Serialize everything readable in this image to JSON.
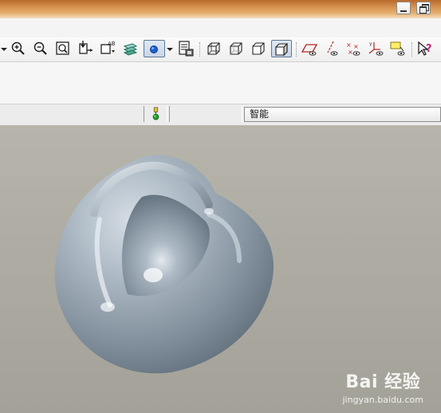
{
  "window": {
    "minimize_icon": "minimize-icon",
    "restore_icon": "restore-icon"
  },
  "toolbar": {
    "buttons": [
      {
        "name": "zoom-in",
        "icon": "zoom-in-icon"
      },
      {
        "name": "zoom-out",
        "icon": "zoom-out-icon"
      },
      {
        "name": "refit",
        "icon": "refit-icon"
      },
      {
        "name": "reorient",
        "icon": "reorient-icon"
      },
      {
        "name": "saved-views",
        "icon": "saved-views-icon"
      },
      {
        "name": "layers",
        "icon": "layers-icon"
      },
      {
        "name": "display-style",
        "icon": "display-style-icon",
        "pressed": true
      },
      {
        "name": "view-manager",
        "icon": "view-manager-icon"
      },
      {
        "name": "wireframe",
        "icon": "wireframe-icon"
      },
      {
        "name": "hidden-line",
        "icon": "hidden-line-icon"
      },
      {
        "name": "no-hidden",
        "icon": "no-hidden-icon"
      },
      {
        "name": "shading",
        "icon": "shading-icon",
        "pressed": true
      },
      {
        "name": "datum-planes",
        "icon": "datum-planes-icon"
      },
      {
        "name": "datum-axes",
        "icon": "datum-axes-icon"
      },
      {
        "name": "datum-points",
        "icon": "datum-points-icon"
      },
      {
        "name": "coordinate-systems",
        "icon": "coordinate-systems-icon"
      },
      {
        "name": "annotations",
        "icon": "annotations-icon"
      },
      {
        "name": "context-help",
        "icon": "context-help-icon"
      }
    ]
  },
  "status": {
    "indicator_icon": "regen-status-icon",
    "filter_value": "智能"
  },
  "watermark": {
    "brand": "Bai 经验",
    "url": "jingyan.baidu.com"
  },
  "colors": {
    "viewport_bg": "#aeaca2",
    "model_surface": "#8a99a6",
    "accent_blue": "#1f5fd6",
    "status_green": "#1fa02a",
    "title_orange": "#d99350"
  }
}
